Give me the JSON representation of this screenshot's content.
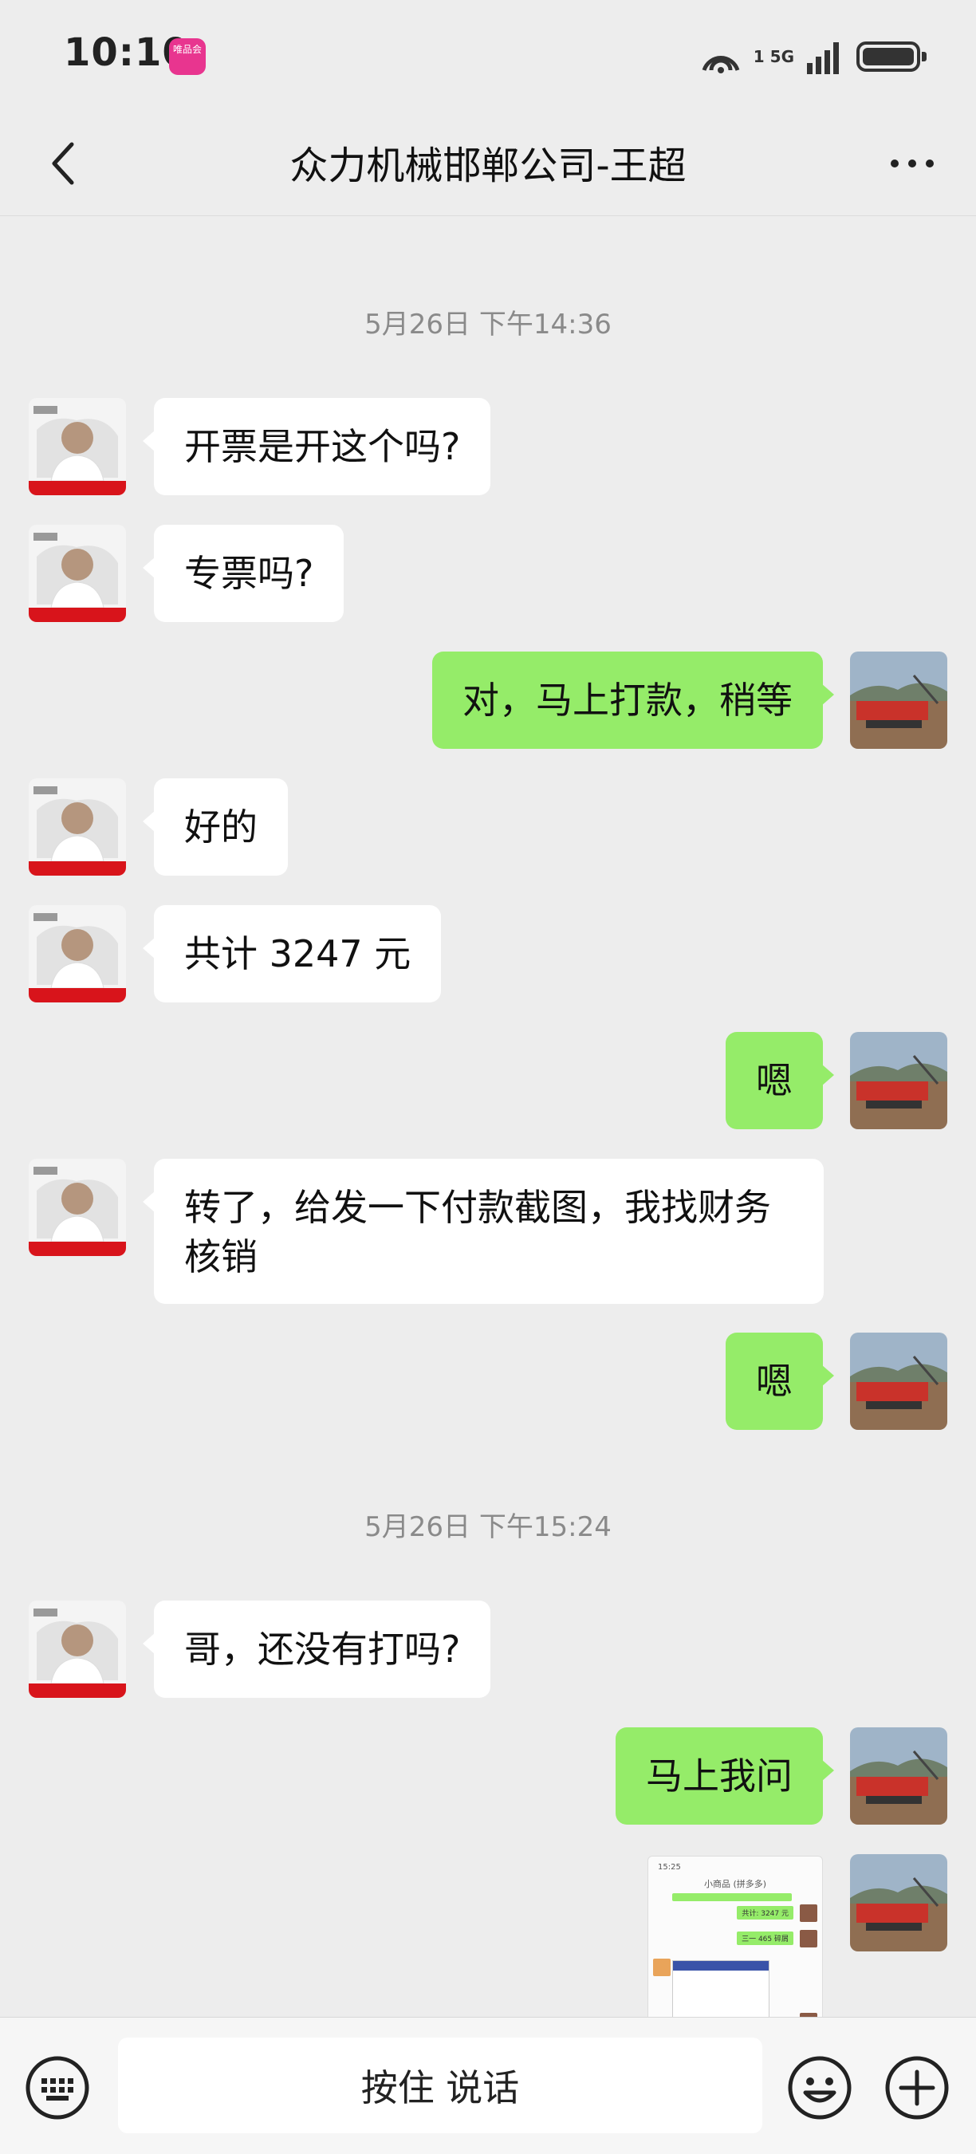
{
  "status_bar": {
    "time": "10:10",
    "app_badge": "唯品会",
    "signal_label": "1 5G"
  },
  "nav": {
    "title": "众力机械邯郸公司-王超"
  },
  "timestamps": {
    "first": "5月26日 下午14:36",
    "second": "5月26日 下午15:24"
  },
  "messages": {
    "m1": "开票是开这个吗?",
    "m2": "专票吗?",
    "m3": "对，马上打款，稍等",
    "m4": "好的",
    "m5": "共计 3247 元",
    "m6": "嗯",
    "m7": "转了，给发一下付款截图，我找财务核销",
    "m8": "嗯",
    "m9": "哥，还没有打吗?",
    "m10": "马上我问"
  },
  "thumbnail": {
    "time": "15:25",
    "title": "小商品 (拼多多)",
    "line1": "共计: 3247 元",
    "line2": "三一 465 碎屑"
  },
  "bottom_bar": {
    "voice_label": "按住 说话"
  },
  "colors": {
    "background": "#ededed",
    "outgoing_bubble": "#95ec69",
    "incoming_bubble": "#ffffff"
  }
}
